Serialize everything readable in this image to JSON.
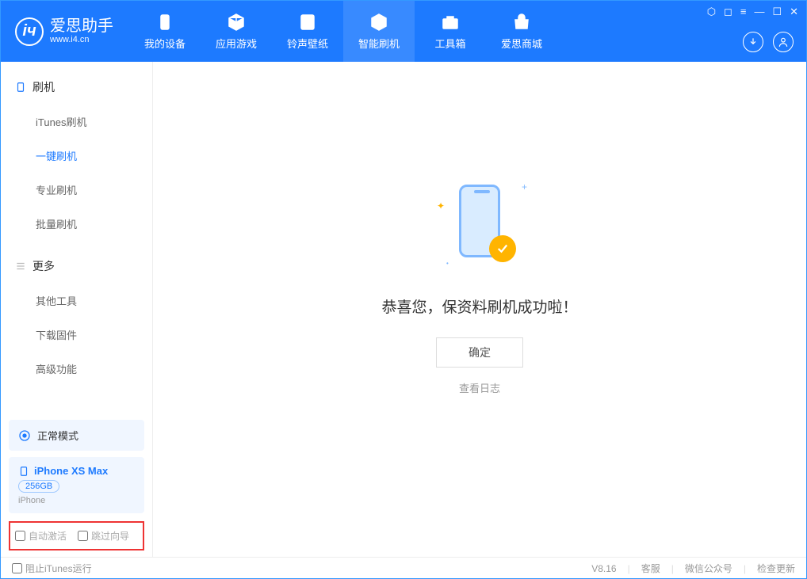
{
  "app": {
    "title": "爱思助手",
    "url": "www.i4.cn"
  },
  "nav": [
    {
      "label": "我的设备",
      "icon": "device"
    },
    {
      "label": "应用游戏",
      "icon": "cube"
    },
    {
      "label": "铃声壁纸",
      "icon": "music"
    },
    {
      "label": "智能刷机",
      "icon": "refresh",
      "active": true
    },
    {
      "label": "工具箱",
      "icon": "toolbox"
    },
    {
      "label": "爱思商城",
      "icon": "shop"
    }
  ],
  "sidebar": {
    "section1": {
      "title": "刷机",
      "items": [
        "iTunes刷机",
        "一键刷机",
        "专业刷机",
        "批量刷机"
      ],
      "activeIndex": 1
    },
    "section2": {
      "title": "更多",
      "items": [
        "其他工具",
        "下载固件",
        "高级功能"
      ]
    }
  },
  "status": {
    "label": "正常模式"
  },
  "device": {
    "name": "iPhone XS Max",
    "storage": "256GB",
    "type": "iPhone"
  },
  "options": {
    "autoActivate": "自动激活",
    "skipGuide": "跳过向导"
  },
  "main": {
    "message": "恭喜您，保资料刷机成功啦！",
    "confirm": "确定",
    "viewLog": "查看日志"
  },
  "footer": {
    "blockItunes": "阻止iTunes运行",
    "version": "V8.16",
    "links": [
      "客服",
      "微信公众号",
      "检查更新"
    ]
  }
}
